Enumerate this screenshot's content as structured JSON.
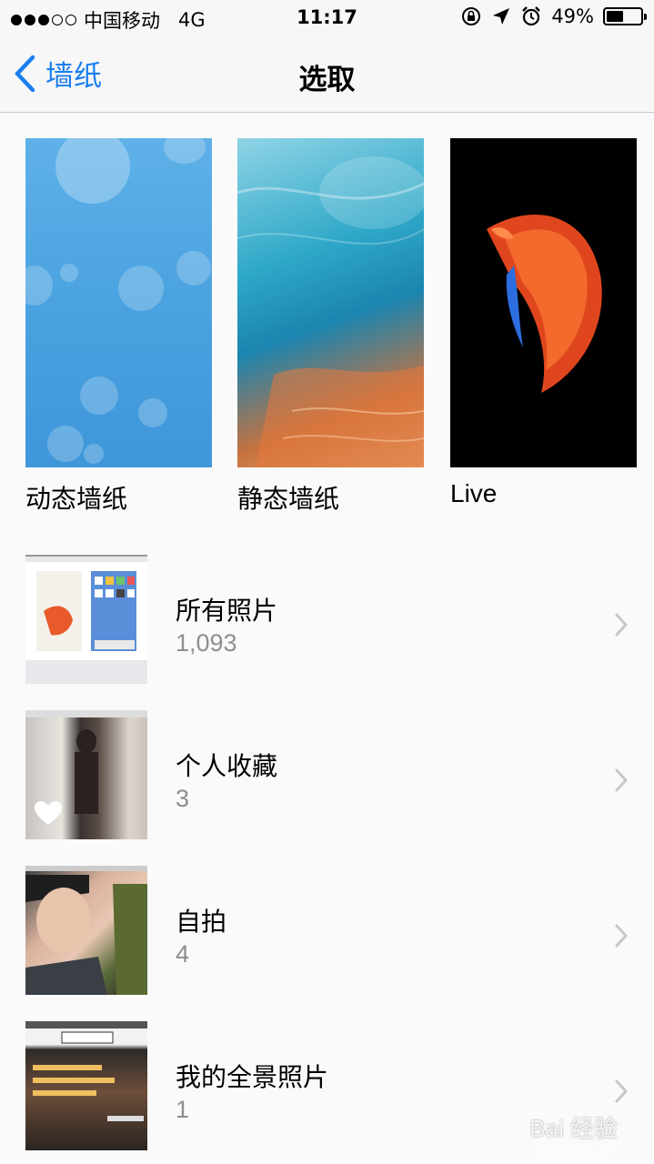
{
  "status_bar": {
    "carrier": "中国移动",
    "network": "4G",
    "time": "11:17",
    "battery_percent": "49%",
    "battery_level": 0.49,
    "signal_bars_filled": 3,
    "signal_bars_total": 5
  },
  "nav": {
    "back_label": "墙纸",
    "title": "选取"
  },
  "wallpapers": [
    {
      "label": "动态墙纸"
    },
    {
      "label": "静态墙纸"
    },
    {
      "label": "Live"
    }
  ],
  "albums": [
    {
      "title": "所有照片",
      "count": "1,093"
    },
    {
      "title": "个人收藏",
      "count": "3"
    },
    {
      "title": "自拍",
      "count": "4"
    },
    {
      "title": "我的全景照片",
      "count": "1"
    }
  ],
  "watermark": {
    "text": "Bai 经验",
    "sub": "jingyan.baidu.com"
  },
  "colors": {
    "accent": "#1a7ef0",
    "secondary_text": "#8e8e93",
    "chevron": "#c7c7cc"
  }
}
